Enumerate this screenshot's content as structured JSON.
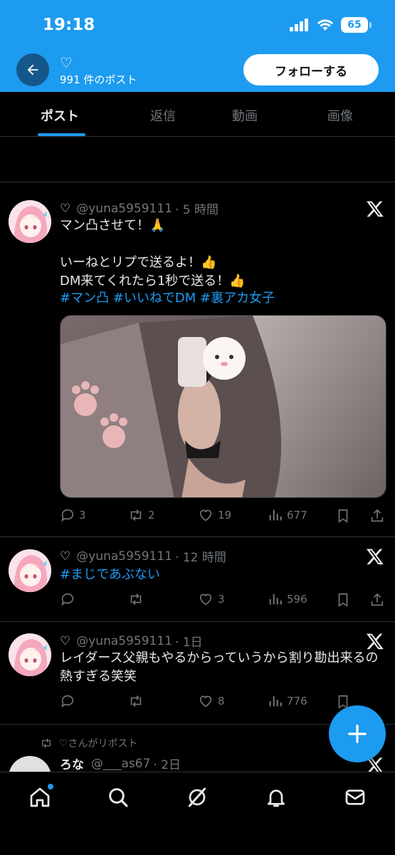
{
  "status_bar": {
    "time": "19:18",
    "battery": "65"
  },
  "profile": {
    "name_heart": "♡",
    "post_count": "991 件のポスト",
    "follow_label": "フォローする"
  },
  "tabs": [
    {
      "label": "ポスト",
      "active": true
    },
    {
      "label": "返信"
    },
    {
      "label": "動画"
    },
    {
      "label": "画像"
    }
  ],
  "posts": [
    {
      "name": "♡",
      "handle": "@yuna5959111",
      "time": "· 5 時間",
      "text_line1": "マン凸させて！🙏",
      "text_body": "いーねとリプで送るよ！👍\nDM来てくれたら1秒で送る！👍",
      "hashtags": "#マン凸 #いいねでDM #裏アカ女子",
      "replies": "3",
      "reposts": "2",
      "likes": "19",
      "views": "677"
    },
    {
      "name": "♡",
      "handle": "@yuna5959111",
      "time": "· 12 時間",
      "hashtags": "#まじであぶない",
      "replies": "",
      "reposts": "",
      "likes": "3",
      "views": "596"
    },
    {
      "name": "♡",
      "handle": "@yuna5959111",
      "time": "· 1日",
      "text": "レイダース父親もやるからっていうから割り勘出来るの熱すぎる笑笑",
      "replies": "",
      "reposts": "",
      "likes": "8",
      "views": "776"
    },
    {
      "repost_by": "♡さんがリポスト",
      "name": "ろな",
      "handle": "@___as67",
      "time": "· 2日"
    }
  ],
  "colors": {
    "accent": "#1d9bf0",
    "background": "#000000",
    "muted": "#71767b"
  },
  "icons": [
    "back-arrow-icon",
    "heart-icon",
    "x-logo-icon",
    "reply-icon",
    "repost-icon",
    "like-icon",
    "views-icon",
    "bookmark-icon",
    "share-icon",
    "compose-plus-icon",
    "home-icon",
    "search-icon",
    "grok-icon",
    "bell-icon",
    "mail-icon"
  ]
}
